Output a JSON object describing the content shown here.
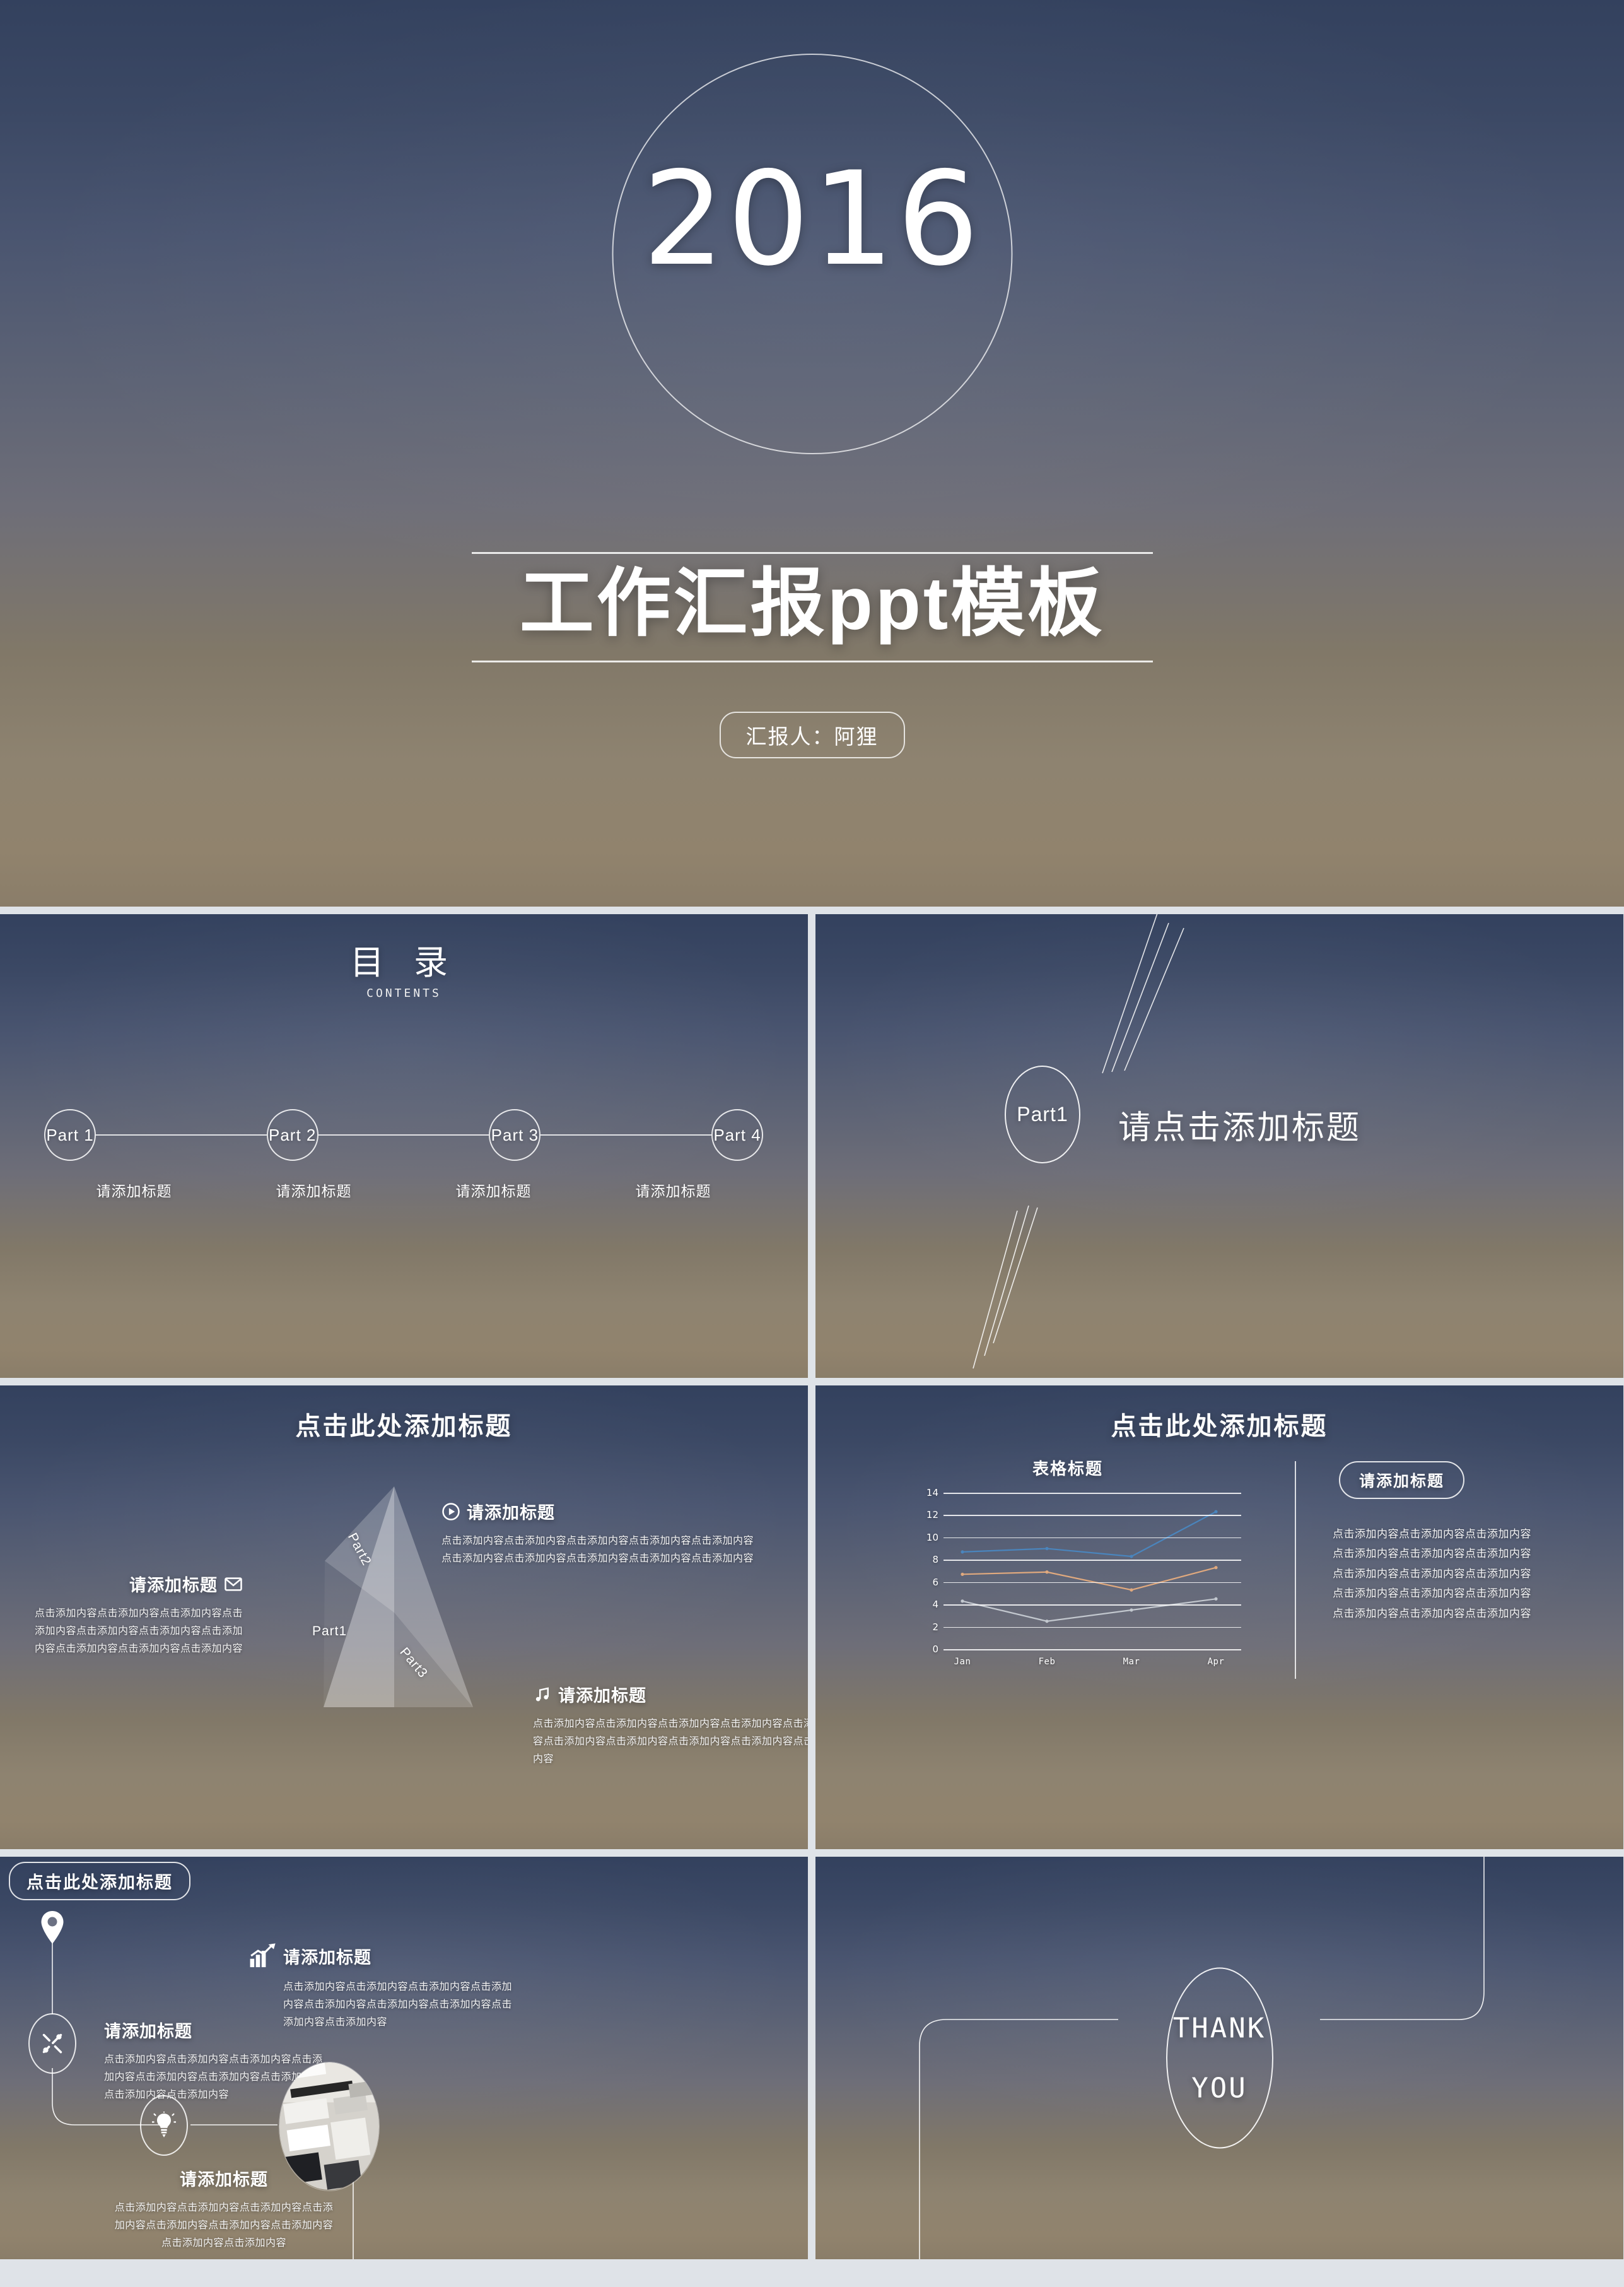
{
  "slide_title": {
    "year": "2016",
    "main_title": "工作汇报ppt模板",
    "presenter": "汇报人：阿狸"
  },
  "slide_contents": {
    "heading_cn": "目 录",
    "heading_en": "CONTENTS",
    "items": [
      {
        "node": "Part 1",
        "label": "请添加标题"
      },
      {
        "node": "Part 2",
        "label": "请添加标题"
      },
      {
        "node": "Part 3",
        "label": "请添加标题"
      },
      {
        "node": "Part 4",
        "label": "请添加标题"
      }
    ]
  },
  "slide_divider": {
    "badge": "Part1",
    "title": "请点击添加标题"
  },
  "slide_triangle": {
    "title": "点击此处添加标题",
    "triangle_labels": [
      "Part1",
      "Part2",
      "Part3"
    ],
    "blocks": [
      {
        "icon": "mail-icon",
        "heading": "请添加标题",
        "body": "点击添加内容点击添加内容点击添加内容点击添加内容点击添加内容点击添加内容点击添加内容点击添加内容点击添加内容点击添加内容"
      },
      {
        "icon": "play-circle-icon",
        "heading": "请添加标题",
        "body": "点击添加内容点击添加内容点击添加内容点击添加内容点击添加内容点击添加内容点击添加内容点击添加内容点击添加内容点击添加内容"
      },
      {
        "icon": "music-note-icon",
        "heading": "请添加标题",
        "body": "点击添加内容点击添加内容点击添加内容点击添加内容点击添加内容点击添加内容点击添加内容点击添加内容点击添加内容点击添加内容"
      }
    ]
  },
  "slide_chart": {
    "title": "点击此处添加标题",
    "side_badge": "请添加标题",
    "side_body": "点击添加内容点击添加内容点击添加内容点击添加内容点击添加内容点击添加内容点击添加内容点击添加内容点击添加内容点击添加内容点击添加内容点击添加内容点击添加内容点击添加内容点击添加内容"
  },
  "chart_data": {
    "type": "line",
    "title": "表格标题",
    "xlabel": "",
    "ylabel": "",
    "categories": [
      "Jan",
      "Feb",
      "Mar",
      "Apr"
    ],
    "series": [
      {
        "name": "series-1",
        "color": "#4a85bd",
        "values": [
          8.7,
          9.0,
          8.3,
          12.3
        ]
      },
      {
        "name": "series-2",
        "color": "#e0a97e",
        "values": [
          6.7,
          6.9,
          5.3,
          7.3
        ]
      },
      {
        "name": "series-3",
        "color": "#c3c8cf",
        "values": [
          4.3,
          2.5,
          3.5,
          4.5
        ]
      }
    ],
    "ylim": [
      0,
      14
    ],
    "yticks": [
      0,
      2,
      4,
      6,
      8,
      10,
      12,
      14
    ],
    "grid": true,
    "legend": "none"
  },
  "slide_roadmap": {
    "title": "点击此处添加标题",
    "blocks": [
      {
        "icon": "tools-icon",
        "heading": "请添加标题",
        "body": "点击添加内容点击添加内容点击添加内容点击添加内容点击添加内容点击添加内容点击添加内容点击添加内容点击添加内容"
      },
      {
        "icon": "lightbulb-icon",
        "heading": "请添加标题",
        "body": "点击添加内容点击添加内容点击添加内容点击添加内容点击添加内容点击添加内容点击添加内容点击添加内容点击添加内容"
      },
      {
        "icon": "chart-growth-icon",
        "heading": "请添加标题",
        "body": "点击添加内容点击添加内容点击添加内容点击添加内容点击添加内容点击添加内容点击添加内容点击添加内容点击添加内容"
      }
    ]
  },
  "slide_thanks": {
    "line1": "THANK",
    "line2": "YOU"
  },
  "colors": {
    "bg_top": "#33415e",
    "bg_mid": "#6e6e78",
    "bg_bottom": "#8a7d69",
    "accent_white": "#ffffff",
    "page_gap": "#dfe3e8"
  }
}
